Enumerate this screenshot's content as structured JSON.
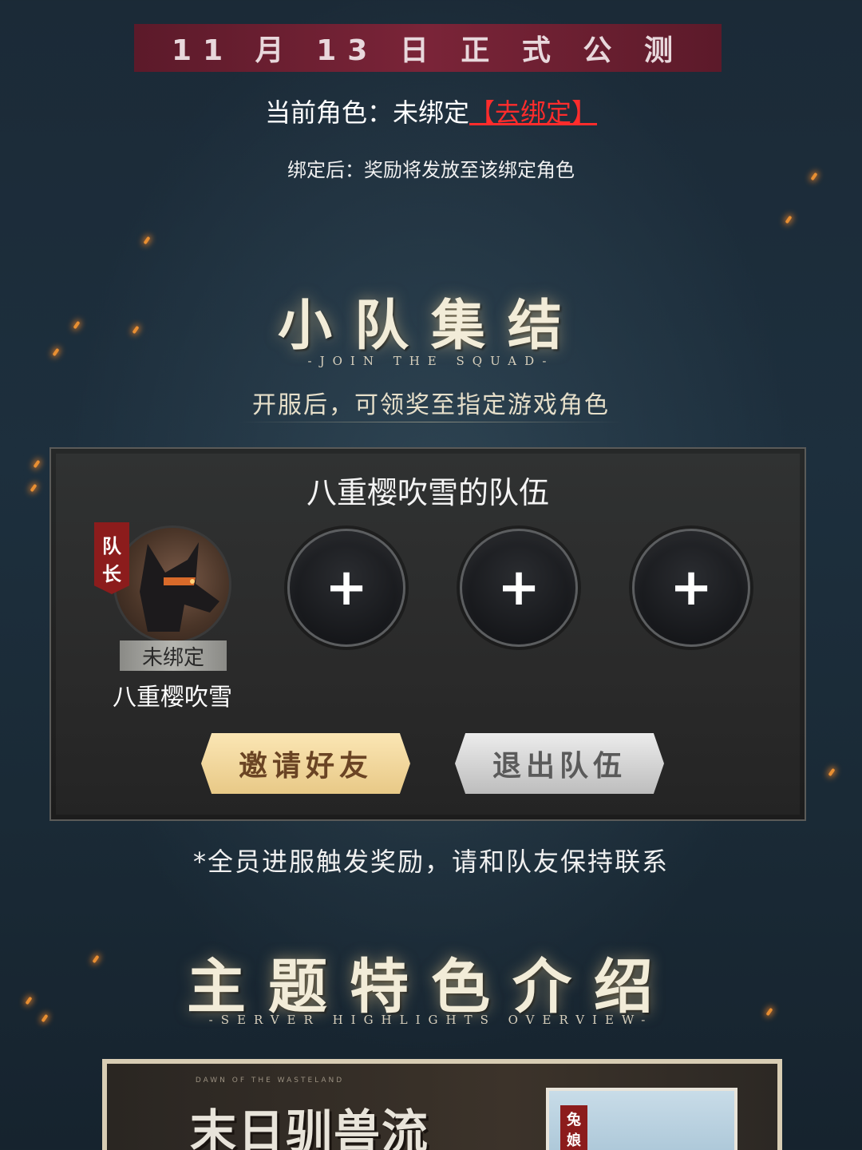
{
  "banner": {
    "text": "11 月 13 日 正 式 公 测"
  },
  "role": {
    "label": "当前角色：未绑定",
    "link": "【去绑定】",
    "note": "绑定后：奖励将发放至该绑定角色"
  },
  "squad": {
    "title": "小队集结",
    "subtitle": "-JOIN THE SQUAD-",
    "hint": "开服后，可领奖至指定游戏角色"
  },
  "team": {
    "name": "八重樱吹雪的队伍",
    "leader_tag": [
      "队",
      "长"
    ],
    "leader_status": "未绑定",
    "leader_name": "八重樱吹雪",
    "slot_plus": "+",
    "invite_label": "邀请好友",
    "quit_label": "退出队伍",
    "note": "*全员进服触发奖励，请和队友保持联系"
  },
  "features": {
    "title": "主题特色介绍",
    "subtitle": "-SERVER HIGHLIGHTS OVERVIEW-",
    "card_small": "DAWN OF THE WASTELAND",
    "card_title": "末日驯兽流",
    "card_tag": [
      "兔",
      "娘"
    ]
  },
  "colors": {
    "banner": "#7a2438",
    "link": "#ff2c2c",
    "leader_tag": "#8c1c1c",
    "invite": "#f4d9a0"
  }
}
